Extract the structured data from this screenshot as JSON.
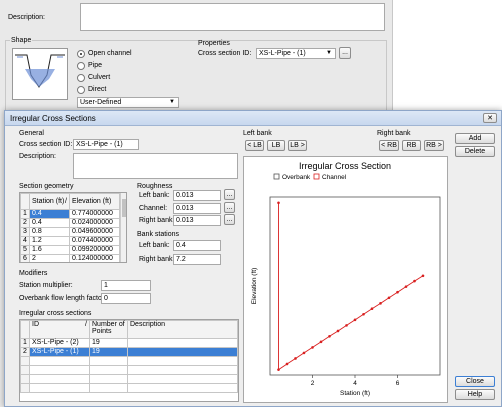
{
  "background_window": {
    "description_label": "Description:",
    "shape_group_title": "Shape",
    "shape_options": [
      {
        "label": "Open channel",
        "selected": true
      },
      {
        "label": "Pipe",
        "selected": false
      },
      {
        "label": "Culvert",
        "selected": false
      },
      {
        "label": "Direct",
        "selected": false
      }
    ],
    "shape_select_value": "User-Defined",
    "properties_title": "Properties",
    "cross_section_id_label": "Cross section ID:",
    "cross_section_id_value": "XS-L-Pipe - (1)",
    "browse_label": "..."
  },
  "dialog": {
    "title": "Irregular Cross Sections",
    "close_x": "✕",
    "general_title": "General",
    "cross_section_id_label": "Cross section ID:",
    "cross_section_id_value": "XS-L-Pipe - (1)",
    "description_label": "Description:",
    "left_bank_label": "Left bank",
    "left_bank_buttons": [
      "< LB",
      "LB",
      "LB >"
    ],
    "right_bank_label": "Right bank",
    "right_bank_buttons": [
      "< RB",
      "RB",
      "RB >"
    ],
    "add_label": "Add",
    "delete_label": "Delete",
    "close_label": "Close",
    "help_label": "Help",
    "section_geometry_title": "Section geometry",
    "geometry_headers": {
      "station": "Station (ft)",
      "sort": "/",
      "elevation": "Elevation (ft)"
    },
    "geometry_rows": [
      {
        "n": "1",
        "station": "0.4",
        "elevation": "0.774000000",
        "selected": true
      },
      {
        "n": "2",
        "station": "0.4",
        "elevation": "0.024000000"
      },
      {
        "n": "3",
        "station": "0.8",
        "elevation": "0.049600000"
      },
      {
        "n": "4",
        "station": "1.2",
        "elevation": "0.074400000"
      },
      {
        "n": "5",
        "station": "1.6",
        "elevation": "0.099200000"
      },
      {
        "n": "6",
        "station": "2",
        "elevation": "0.124000000"
      }
    ],
    "roughness_title": "Roughness",
    "left_bank_n_label": "Left bank:",
    "left_bank_n": "0.013",
    "channel_n_label": "Channel:",
    "channel_n": "0.013",
    "right_bank_n_label": "Right bank:",
    "right_bank_n": "0.013",
    "bank_stations_title": "Bank stations",
    "left_bank_station_label": "Left bank:",
    "left_bank_station": "0.4",
    "right_bank_station_label": "Right bank:",
    "right_bank_station": "7.2",
    "modifiers_title": "Modifiers",
    "station_multiplier_label": "Station multiplier:",
    "station_multiplier": "1",
    "overbank_factor_label": "Overbank flow length factor:",
    "overbank_factor": "0",
    "irregular_title": "Irregular cross sections",
    "irregular_headers": {
      "id": "ID",
      "sort": "/",
      "points": "Number of Points",
      "description": "Description"
    },
    "irregular_rows": [
      {
        "n": "1",
        "id": "XS-L-Pipe - (2)",
        "points": "19",
        "description": ""
      },
      {
        "n": "2",
        "id": "XS-L-Pipe - (1)",
        "points": "19",
        "description": "",
        "selected": true
      }
    ]
  },
  "chart_data": {
    "type": "scatter",
    "title": "Irregular Cross Section",
    "legend": [
      "Overbank",
      "Channel"
    ],
    "legend_colors": {
      "overbank": "#555555",
      "channel": "#d92020"
    },
    "xlabel": "Station (ft)",
    "ylabel": "Elevation (ft)",
    "xlim": [
      0,
      8
    ],
    "ylim": [
      0,
      0.8
    ],
    "xticks": [
      "2",
      "4",
      "6"
    ],
    "series": [
      {
        "name": "Channel",
        "color": "#d92020",
        "x": [
          0.4,
          0.4,
          0.8,
          1.2,
          1.6,
          2.0,
          2.4,
          2.8,
          3.2,
          3.6,
          4.0,
          4.4,
          4.8,
          5.2,
          5.6,
          6.0,
          6.4,
          6.8,
          7.2
        ],
        "y": [
          0.774,
          0.024,
          0.0496,
          0.0744,
          0.0992,
          0.124,
          0.149,
          0.174,
          0.198,
          0.223,
          0.248,
          0.273,
          0.298,
          0.322,
          0.347,
          0.372,
          0.397,
          0.422,
          0.446
        ]
      }
    ]
  }
}
